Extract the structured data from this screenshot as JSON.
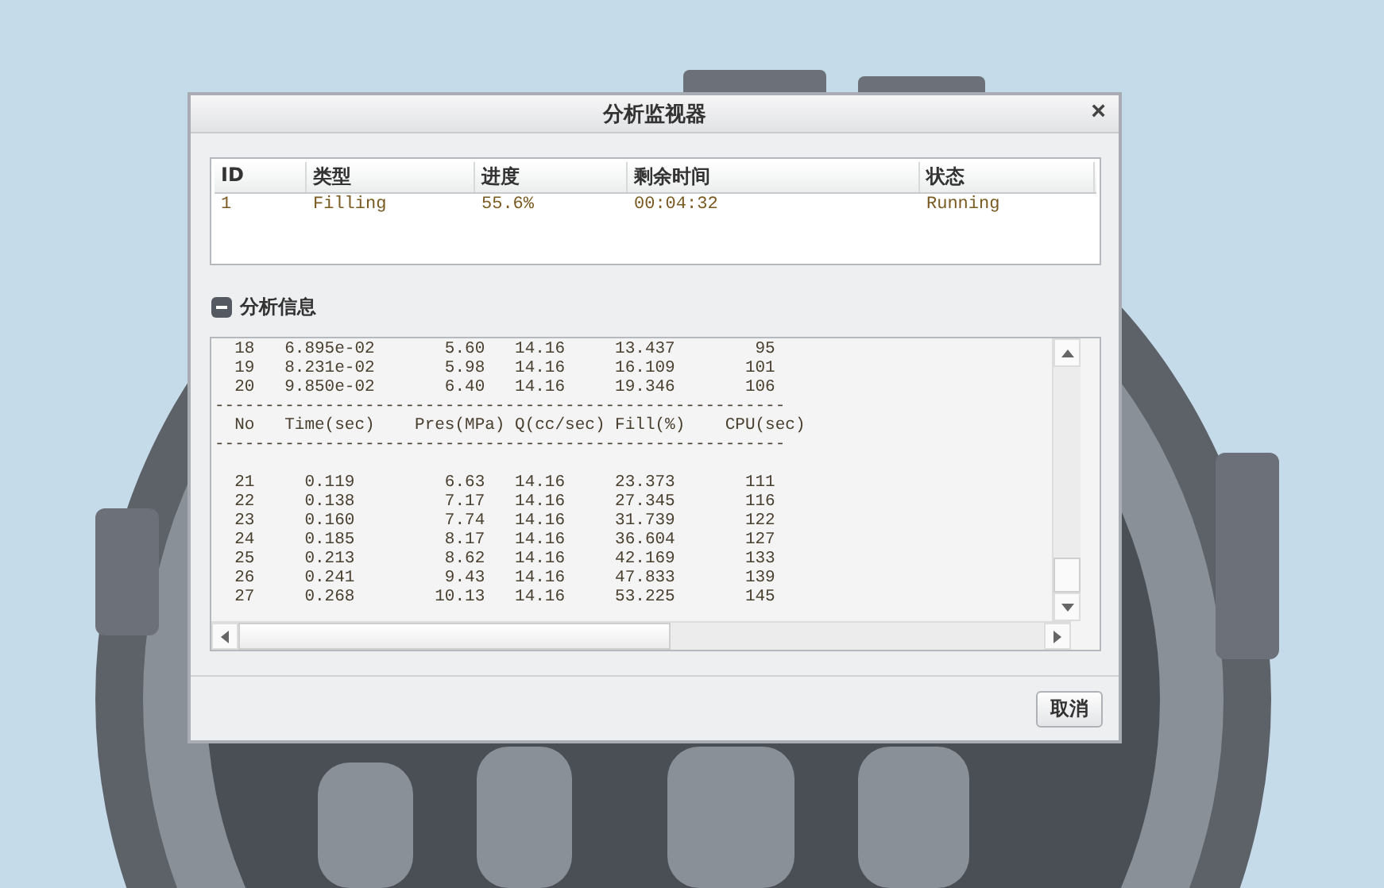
{
  "window": {
    "title": "分析监视器",
    "close": "×"
  },
  "jobs": {
    "columns": [
      "ID",
      "类型",
      "进度",
      "剩余时间",
      "状态"
    ],
    "rows": [
      {
        "cells": [
          "1",
          "Filling",
          "55.6%",
          "00:04:32",
          "Running"
        ]
      }
    ]
  },
  "section": {
    "title": "分析信息",
    "expanded": true
  },
  "log": [
    "  18   6.895e-02       5.60   14.16     13.437        95",
    "  19   8.231e-02       5.98   14.16     16.109       101",
    "  20   9.850e-02       6.40   14.16     19.346       106",
    "---------------------------------------------------------",
    "  No   Time(sec)    Pres(MPa) Q(cc/sec) Fill(%)    CPU(sec)",
    "---------------------------------------------------------",
    "  21     0.119         6.63   14.16     23.373       111",
    "  22     0.138         7.17   14.16     27.345       116",
    "  23     0.160         7.74   14.16     31.739       122",
    "  24     0.185         8.17   14.16     36.604       127",
    "  25     0.213         8.62   14.16     42.169       133",
    "  26     0.241         9.43   14.16     47.833       139",
    "  27     0.268        10.13   14.16     53.225       145"
  ],
  "buttons": [
    "取消"
  ]
}
